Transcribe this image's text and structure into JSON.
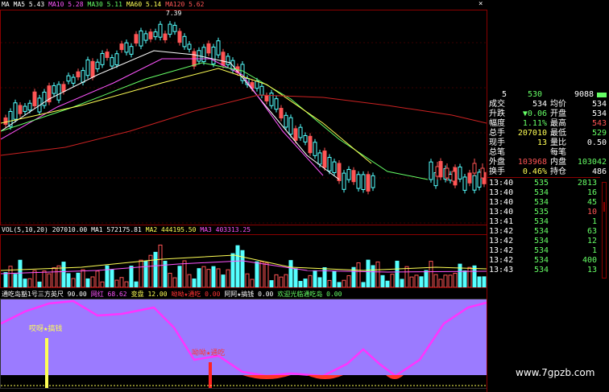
{
  "app": {
    "top_price_label": "7.39",
    "watermark": "www.7gpzb.com"
  },
  "ma_legend": [
    {
      "text": "MA",
      "color": "#ffffff"
    },
    {
      "text": "MA5 5.43",
      "color": "#ffffff"
    },
    {
      "text": "MA10 5.28",
      "color": "#ff55ff"
    },
    {
      "text": "MA30 5.11",
      "color": "#66ff66"
    },
    {
      "text": "MA60 5.14",
      "color": "#ffff55"
    },
    {
      "text": "MA120 5.62",
      "color": "#ff5555"
    }
  ],
  "vol_legend": [
    {
      "text": "VOL(5,10,20)",
      "color": "#ffffff"
    },
    {
      "text": "207010.00",
      "color": "#ffffff"
    },
    {
      "text": "MA1 572175.81",
      "color": "#ffffff"
    },
    {
      "text": "MA2 444195.50",
      "color": "#ffff55"
    },
    {
      "text": "MA3 403313.25",
      "color": "#ff55ff"
    }
  ],
  "ind_legend": [
    {
      "text": "通吃岛豁1号三方英尺 90.00",
      "color": "#ffffff"
    },
    {
      "text": "网红 68.62",
      "color": "#ff55ff"
    },
    {
      "text": "变盘 12.00",
      "color": "#ffff55"
    },
    {
      "text": "呦呦★通吃 0.00",
      "color": "#ff3333"
    },
    {
      "text": "阿阿★搞钱 0.00",
      "color": "#ffffff"
    },
    {
      "text": "欢迎光临通吃岛 0.00",
      "color": "#66ff66"
    }
  ],
  "annotations": {
    "left_label": "哎呀★搞钱",
    "mid_label": "呦呦★通吃",
    "float_label": "—"
  },
  "quote_header": {
    "left": "5",
    "mid": "530",
    "right": "9088"
  },
  "quote_rows": [
    {
      "l1": "成交",
      "v1": "534",
      "l2": "均价",
      "v2": "534",
      "c1": "#ffffff",
      "c2": "#ffffff"
    },
    {
      "l1": "升跌",
      "v1": "▼0.06",
      "l2": "开盘",
      "v2": "534",
      "c1": "#66ff66",
      "c2": "#ffffff"
    },
    {
      "l1": "幅度",
      "v1": "1.11%",
      "l2": "最高",
      "v2": "543",
      "c1": "#66ff66",
      "c2": "#ff5555"
    },
    {
      "l1": "总手",
      "v1": "207010",
      "l2": "最低",
      "v2": "529",
      "c1": "#ffff55",
      "c2": "#66ff66"
    },
    {
      "l1": "现手",
      "v1": "13",
      "l2": "量比",
      "v2": "0.50",
      "c1": "#ffff55",
      "c2": "#ffffff"
    },
    {
      "l1": "总笔",
      "v1": "",
      "l2": "每笔",
      "v2": "",
      "c1": "#ffffff",
      "c2": "#ffffff"
    },
    {
      "l1": "外盘",
      "v1": "103968",
      "l2": "内盘",
      "v2": "103042",
      "c1": "#ff5555",
      "c2": "#66ff66"
    },
    {
      "l1": "换手",
      "v1": "0.46%",
      "l2": "持仓",
      "v2": "486",
      "c1": "#ffff55",
      "c2": "#ffffff"
    }
  ],
  "ticks": [
    {
      "t": "13:40",
      "p": "535",
      "v": "2813",
      "pc": "#66ff66",
      "vc": "#66ff66"
    },
    {
      "t": "13:40",
      "p": "534",
      "v": "16",
      "pc": "#66ff66",
      "vc": "#66ff66"
    },
    {
      "t": "13:40",
      "p": "534",
      "v": "45",
      "pc": "#66ff66",
      "vc": "#66ff66"
    },
    {
      "t": "13:40",
      "p": "535",
      "v": "10",
      "pc": "#66ff66",
      "vc": "#ff5555"
    },
    {
      "t": "13:41",
      "p": "534",
      "v": "1",
      "pc": "#66ff66",
      "vc": "#66ff66"
    },
    {
      "t": "13:42",
      "p": "534",
      "v": "63",
      "pc": "#66ff66",
      "vc": "#66ff66"
    },
    {
      "t": "13:42",
      "p": "534",
      "v": "12",
      "pc": "#66ff66",
      "vc": "#66ff66"
    },
    {
      "t": "13:42",
      "p": "534",
      "v": "1",
      "pc": "#66ff66",
      "vc": "#66ff66"
    },
    {
      "t": "13:42",
      "p": "534",
      "v": "400",
      "pc": "#66ff66",
      "vc": "#66ff66"
    },
    {
      "t": "13:43",
      "p": "534",
      "v": "13",
      "pc": "#66ff66",
      "vc": "#66ff66"
    }
  ],
  "colors": {
    "up": "#55ffff",
    "down": "#ff5555",
    "grid": "#8b0000",
    "indicator_fill": "#9b7bff",
    "indicator_line": "#ff33ff"
  }
}
